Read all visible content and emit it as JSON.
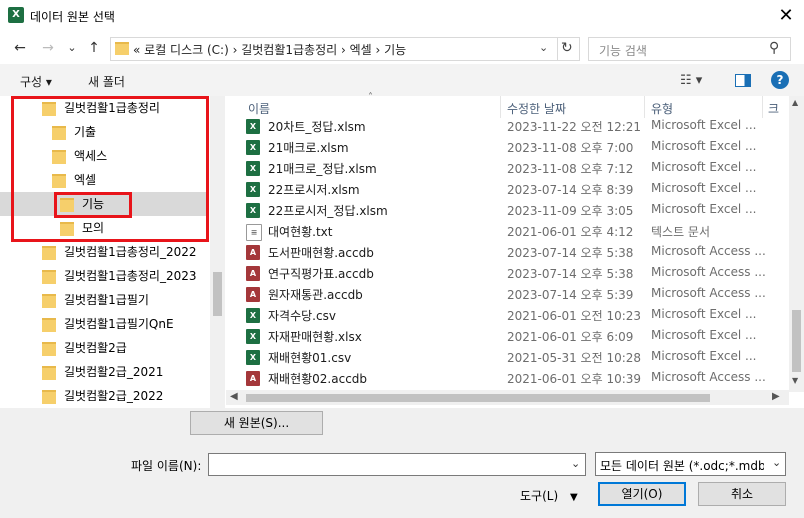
{
  "window": {
    "title": "데이터 원본 선택",
    "app_icon": "X"
  },
  "nav": {
    "back": "←",
    "forward": "→",
    "recent": "⌄",
    "up": "↑",
    "address": "« 로컬 디스크 (C:)  ›  길벗컴활1급총정리  ›  엑셀  ›  기능",
    "search_placeholder": "기능 검색"
  },
  "toolbar": {
    "organize": "구성 ▾",
    "new_folder": "새 폴더"
  },
  "tree": [
    {
      "label": "길벗컴활1급총정리",
      "indent": 0
    },
    {
      "label": "기출",
      "indent": 1
    },
    {
      "label": "액세스",
      "indent": 1
    },
    {
      "label": "엑셀",
      "indent": 1
    },
    {
      "label": "기능",
      "indent": 2,
      "selected": true
    },
    {
      "label": "모의",
      "indent": 2
    },
    {
      "label": "길벗컴활1급총정리_2022",
      "indent": 0
    },
    {
      "label": "길벗컴활1급총정리_2023",
      "indent": 0
    },
    {
      "label": "길벗컴활1급필기",
      "indent": 0
    },
    {
      "label": "길벗컴활1급필기QnE",
      "indent": 0
    },
    {
      "label": "길벗컴활2급",
      "indent": 0
    },
    {
      "label": "길벗컴활2급_2021",
      "indent": 0
    },
    {
      "label": "길벗컴활2급_2022",
      "indent": 0
    }
  ],
  "columns": {
    "name": "이름",
    "modified": "수정한 날짜",
    "type": "유형",
    "size": "크"
  },
  "files": [
    {
      "name": "20차트_정답.xlsm",
      "date": "2023-11-22 오전 12:21",
      "type": "Microsoft Excel ...",
      "kind": "excel"
    },
    {
      "name": "21매크로.xlsm",
      "date": "2023-11-08 오후 7:00",
      "type": "Microsoft Excel ...",
      "kind": "excel"
    },
    {
      "name": "21매크로_정답.xlsm",
      "date": "2023-11-08 오후 7:12",
      "type": "Microsoft Excel ...",
      "kind": "excel"
    },
    {
      "name": "22프로시저.xlsm",
      "date": "2023-07-14 오후 8:39",
      "type": "Microsoft Excel ...",
      "kind": "excel"
    },
    {
      "name": "22프로시저_정답.xlsm",
      "date": "2023-11-09 오후 3:05",
      "type": "Microsoft Excel ...",
      "kind": "excel"
    },
    {
      "name": "대여현황.txt",
      "date": "2021-06-01 오후 4:12",
      "type": "텍스트 문서",
      "kind": "text"
    },
    {
      "name": "도서판매현황.accdb",
      "date": "2023-07-14 오후 5:38",
      "type": "Microsoft Access ...",
      "kind": "access"
    },
    {
      "name": "연구직평가표.accdb",
      "date": "2023-07-14 오후 5:38",
      "type": "Microsoft Access ...",
      "kind": "access"
    },
    {
      "name": "원자재통관.accdb",
      "date": "2023-07-14 오후 5:39",
      "type": "Microsoft Access ...",
      "kind": "access"
    },
    {
      "name": "자격수당.csv",
      "date": "2021-06-01 오전 10:23",
      "type": "Microsoft Excel ...",
      "kind": "excel"
    },
    {
      "name": "자재판매현황.xlsx",
      "date": "2021-06-01 오후 6:09",
      "type": "Microsoft Excel ...",
      "kind": "excel"
    },
    {
      "name": "재배현황01.csv",
      "date": "2021-05-31 오전 10:28",
      "type": "Microsoft Excel ...",
      "kind": "excel"
    },
    {
      "name": "재배현황02.accdb",
      "date": "2021-06-01 오후 10:39",
      "type": "Microsoft Access ...",
      "kind": "access"
    }
  ],
  "new_source_button": "새 원본(S)...",
  "filename": {
    "label": "파일 이름(N):",
    "value": ""
  },
  "filter": {
    "selected": "모든 데이터 원본 (*.odc;*.mdb"
  },
  "tools": "도구(L)",
  "open_button": "열기(O)",
  "cancel_button": "취소",
  "colors": {
    "excel": "#1d6f42",
    "access": "#a4373a",
    "highlight": "#e8141a",
    "selected": "#cce8ff"
  }
}
